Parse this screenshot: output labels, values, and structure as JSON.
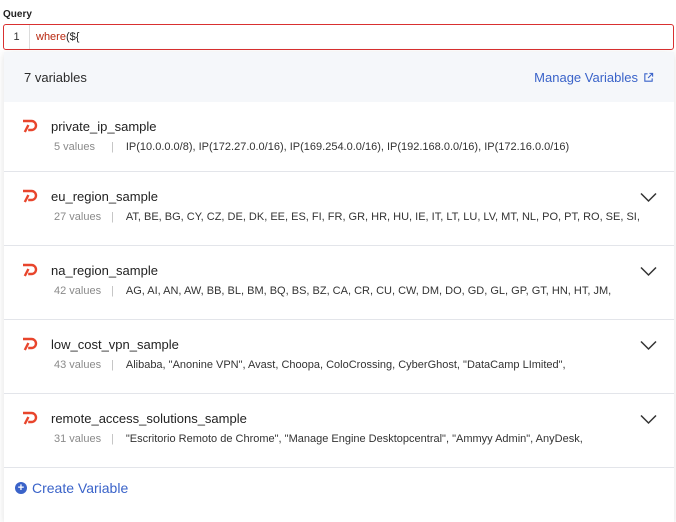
{
  "query": {
    "label": "Query",
    "line_number": "1",
    "keyword": "where",
    "rest": "(${"
  },
  "panel": {
    "count_text": "7 variables",
    "manage_label": "Manage Variables",
    "create_label": "Create Variable"
  },
  "variables": [
    {
      "name": "private_ip_sample",
      "count": "5 values",
      "values": "IP(10.0.0.0/8), IP(172.27.0.0/16), IP(169.254.0.0/16), IP(192.168.0.0/16), IP(172.16.0.0/16)",
      "expandable": false
    },
    {
      "name": "eu_region_sample",
      "count": "27 values",
      "values": "AT, BE, BG, CY, CZ, DE, DK, EE, ES, FI, FR, GR, HR, HU, IE, IT, LT, LU, LV, MT, NL, PO, PT, RO, SE, SI,",
      "expandable": true
    },
    {
      "name": "na_region_sample",
      "count": "42 values",
      "values": "AG, AI, AN, AW, BB, BL, BM, BQ, BS, BZ, CA, CR, CU, CW, DM, DO, GD, GL, GP, GT, HN, HT, JM,",
      "expandable": true
    },
    {
      "name": "low_cost_vpn_sample",
      "count": "43 values",
      "values": "Alibaba, \"Anonine VPN\", Avast, Choopa, ColoCrossing, CyberGhost, \"DataCamp LImited\",",
      "expandable": true
    },
    {
      "name": "remote_access_solutions_sample",
      "count": "31 values",
      "values": "\"Escritorio Remoto de Chrome\", \"Manage Engine Desktopcentral\", \"Ammyy Admin\", AnyDesk,",
      "expandable": true
    }
  ],
  "icons": {
    "variable": "variable-icon",
    "expand": "chevron-down-icon",
    "external": "external-link-icon",
    "add": "plus-circle-icon"
  },
  "colors": {
    "accent": "#3a63c9",
    "error_border": "#d93030",
    "variable_icon": "#e8452c"
  }
}
